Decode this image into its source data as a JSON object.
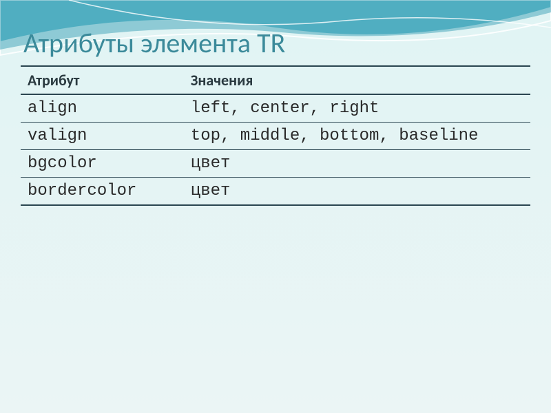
{
  "title": "Атрибуты элемента TR",
  "headers": {
    "col1": "Атрибут",
    "col2": "Значения"
  },
  "rows": [
    {
      "attr": "align",
      "values": "left, center, right"
    },
    {
      "attr": "valign",
      "values": "top, middle, bottom, baseline"
    },
    {
      "attr": "bgcolor",
      "values": "цвет"
    },
    {
      "attr": "bordercolor",
      "values": "цвет"
    }
  ]
}
